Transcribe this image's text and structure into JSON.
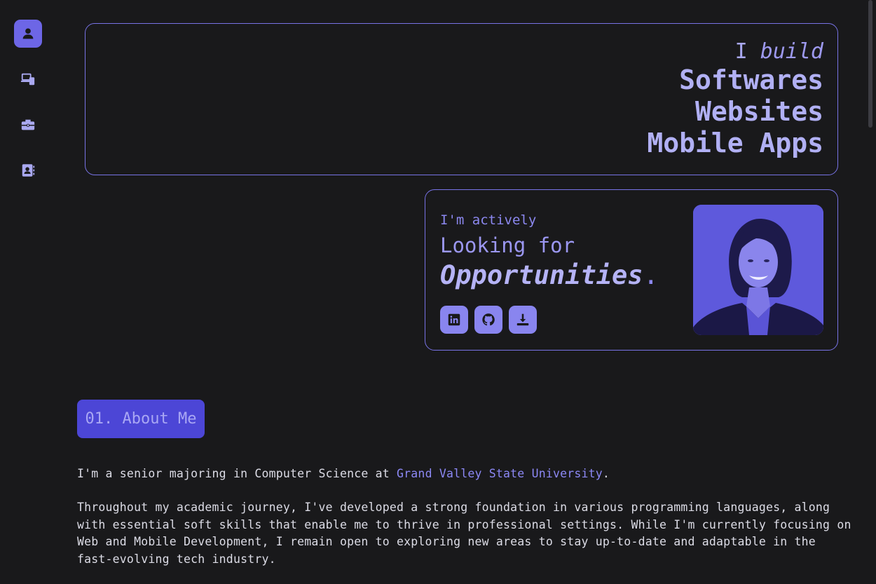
{
  "nav": {
    "items": [
      {
        "icon": "user-icon",
        "active": true
      },
      {
        "icon": "devices-icon",
        "active": false
      },
      {
        "icon": "briefcase-icon",
        "active": false
      },
      {
        "icon": "contact-book-icon",
        "active": false
      }
    ]
  },
  "hero": {
    "prefix": "I",
    "verb": "build",
    "lines": [
      "Softwares",
      "Websites",
      "Mobile Apps"
    ]
  },
  "opportunity": {
    "small": "I'm actively",
    "medium": "Looking for",
    "large": "Opportunities",
    "dot": ".",
    "socials": [
      {
        "icon": "linkedin-icon"
      },
      {
        "icon": "github-icon"
      },
      {
        "icon": "download-icon"
      }
    ]
  },
  "about": {
    "title": "01. About Me",
    "p1_prefix": "I'm a senior majoring in Computer Science at ",
    "p1_link": "Grand Valley State University",
    "p1_suffix": ".",
    "p2": "Throughout my academic journey, I've developed a strong foundation in various programming languages, along with essential soft skills that enable me to thrive in professional settings. While I'm currently focusing on Web and Mobile Development, I remain open to exploring new areas to stay up-to-date and adaptable in the fast-evolving tech industry."
  },
  "colors": {
    "accent": "#6d66e6",
    "background": "#19191b",
    "border": "#7873e6"
  }
}
